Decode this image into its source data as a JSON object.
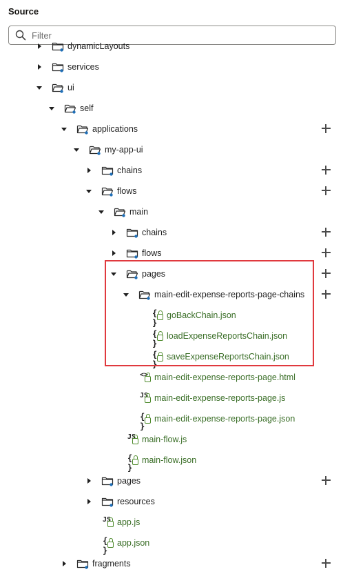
{
  "panel": {
    "title": "Source"
  },
  "filter": {
    "placeholder": "Filter",
    "value": ""
  },
  "tree": {
    "items": [
      {
        "label": "dynamicLayouts",
        "kind": "folder",
        "state": "collapsed",
        "icon": "folder-icon",
        "add": false
      },
      {
        "label": "services",
        "kind": "folder",
        "state": "collapsed",
        "icon": "folder-icon",
        "add": false
      },
      {
        "label": "ui",
        "kind": "folder",
        "state": "expanded",
        "icon": "folder-open-icon",
        "add": false
      },
      {
        "label": "self",
        "kind": "folder",
        "state": "expanded",
        "icon": "folder-open-icon",
        "add": false
      },
      {
        "label": "applications",
        "kind": "folder",
        "state": "expanded",
        "icon": "folder-open-icon",
        "add": true
      },
      {
        "label": "my-app-ui",
        "kind": "folder",
        "state": "expanded",
        "icon": "folder-open-icon",
        "add": false
      },
      {
        "label": "chains",
        "kind": "folder",
        "state": "collapsed",
        "icon": "folder-icon",
        "add": true
      },
      {
        "label": "flows",
        "kind": "folder",
        "state": "expanded",
        "icon": "folder-open-icon",
        "add": true
      },
      {
        "label": "main",
        "kind": "folder",
        "state": "expanded",
        "icon": "folder-open-icon",
        "add": false
      },
      {
        "label": "chains",
        "kind": "folder",
        "state": "collapsed",
        "icon": "folder-icon",
        "add": true
      },
      {
        "label": "flows",
        "kind": "folder",
        "state": "collapsed",
        "icon": "folder-icon",
        "add": true
      },
      {
        "label": "pages",
        "kind": "folder",
        "state": "expanded",
        "icon": "folder-open-icon",
        "add": true
      },
      {
        "label": "main-edit-expense-reports-page-chains",
        "kind": "folder",
        "state": "expanded",
        "icon": "folder-open-icon",
        "add": true
      },
      {
        "label": "goBackChain.json",
        "kind": "file",
        "filetype": "json",
        "icon": "json-file-icon"
      },
      {
        "label": "loadExpenseReportsChain.json",
        "kind": "file",
        "filetype": "json",
        "icon": "json-file-icon"
      },
      {
        "label": "saveExpenseReportsChain.json",
        "kind": "file",
        "filetype": "json",
        "icon": "json-file-icon"
      },
      {
        "label": "main-edit-expense-reports-page.html",
        "kind": "file",
        "filetype": "html",
        "icon": "html-file-icon"
      },
      {
        "label": "main-edit-expense-reports-page.js",
        "kind": "file",
        "filetype": "js",
        "icon": "js-file-icon"
      },
      {
        "label": "main-edit-expense-reports-page.json",
        "kind": "file",
        "filetype": "json",
        "icon": "json-file-icon"
      },
      {
        "label": "main-flow.js",
        "kind": "file",
        "filetype": "js",
        "icon": "js-file-icon"
      },
      {
        "label": "main-flow.json",
        "kind": "file",
        "filetype": "json",
        "icon": "json-file-icon"
      },
      {
        "label": "pages",
        "kind": "folder",
        "state": "collapsed",
        "icon": "folder-icon",
        "add": true
      },
      {
        "label": "resources",
        "kind": "folder",
        "state": "collapsed",
        "icon": "folder-icon",
        "add": false
      },
      {
        "label": "app.js",
        "kind": "file",
        "filetype": "js",
        "icon": "js-file-icon"
      },
      {
        "label": "app.json",
        "kind": "file",
        "filetype": "json",
        "icon": "json-file-icon"
      },
      {
        "label": "fragments",
        "kind": "folder",
        "state": "collapsed",
        "icon": "folder-icon",
        "add": true
      }
    ]
  },
  "glyphs": {
    "json": "{ }",
    "js": "JS",
    "html": "<>"
  },
  "colors": {
    "accent": "#1f6fb8",
    "file_text": "#3a6e27",
    "highlight": "#e0393e"
  }
}
